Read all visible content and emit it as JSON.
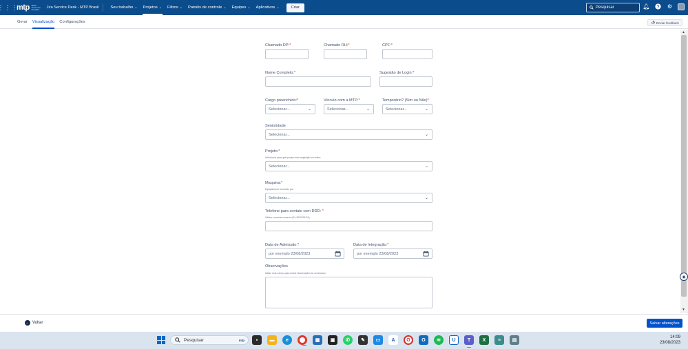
{
  "topnav": {
    "app_title": "Jira Service Desk - MTP Brasil",
    "logo_text": "mtp",
    "logo_sub": "Make Tomorrow Possible",
    "items": [
      {
        "label": "Seu trabalho"
      },
      {
        "label": "Projetos"
      },
      {
        "label": "Filtros"
      },
      {
        "label": "Painéis de controle"
      },
      {
        "label": "Equipes"
      },
      {
        "label": "Aplicativos"
      }
    ],
    "create_label": "Criar",
    "search_placeholder": "Pesquisar"
  },
  "tabs": [
    {
      "label": "Gerar"
    },
    {
      "label": "Visualização"
    },
    {
      "label": "Configurações"
    }
  ],
  "feedback_label": "Enviar feedback",
  "form": {
    "chamado_dp": "Chamado DP:",
    "chamado_rh": "Chamado RH:",
    "cpf": "CPF:",
    "nome_completo": "Nome Completo:",
    "sugestao_login": "Sugestão de Login:",
    "cargo": "Cargo preenchido:",
    "vinculo": "Vínculo com a MTP:",
    "temporario": "Temporário? (Sim ou Não)",
    "senioridade": "Senioridade",
    "projeto": "Projeto:",
    "projeto_help": "Selecionar para qual projeto esta requisição se refere",
    "maquina": "Maquina:",
    "maquina_help": "Equipamento fornecido por:",
    "telefone": "Telefone para contato com DDD:",
    "telefone_help": "Utilizar somente numeros (Ex 3000001111)",
    "data_admissao": "Data de Admissão:",
    "data_integracao": "Data de Integração:",
    "date_placeholder": "por exemplo 23/08/2023",
    "observacoes": "Observações",
    "observacoes_help": "Utilize este campo para inserir observações se necessario",
    "required_mark": "*",
    "select_placeholder": "Selecionar..."
  },
  "footer": {
    "back_label": "Voltar",
    "save_label": "Salvar alterações"
  },
  "taskbar": {
    "search_label": "Pesquisar",
    "search_brand": "mtp",
    "time": "14:09",
    "date": "23/08/2023"
  }
}
